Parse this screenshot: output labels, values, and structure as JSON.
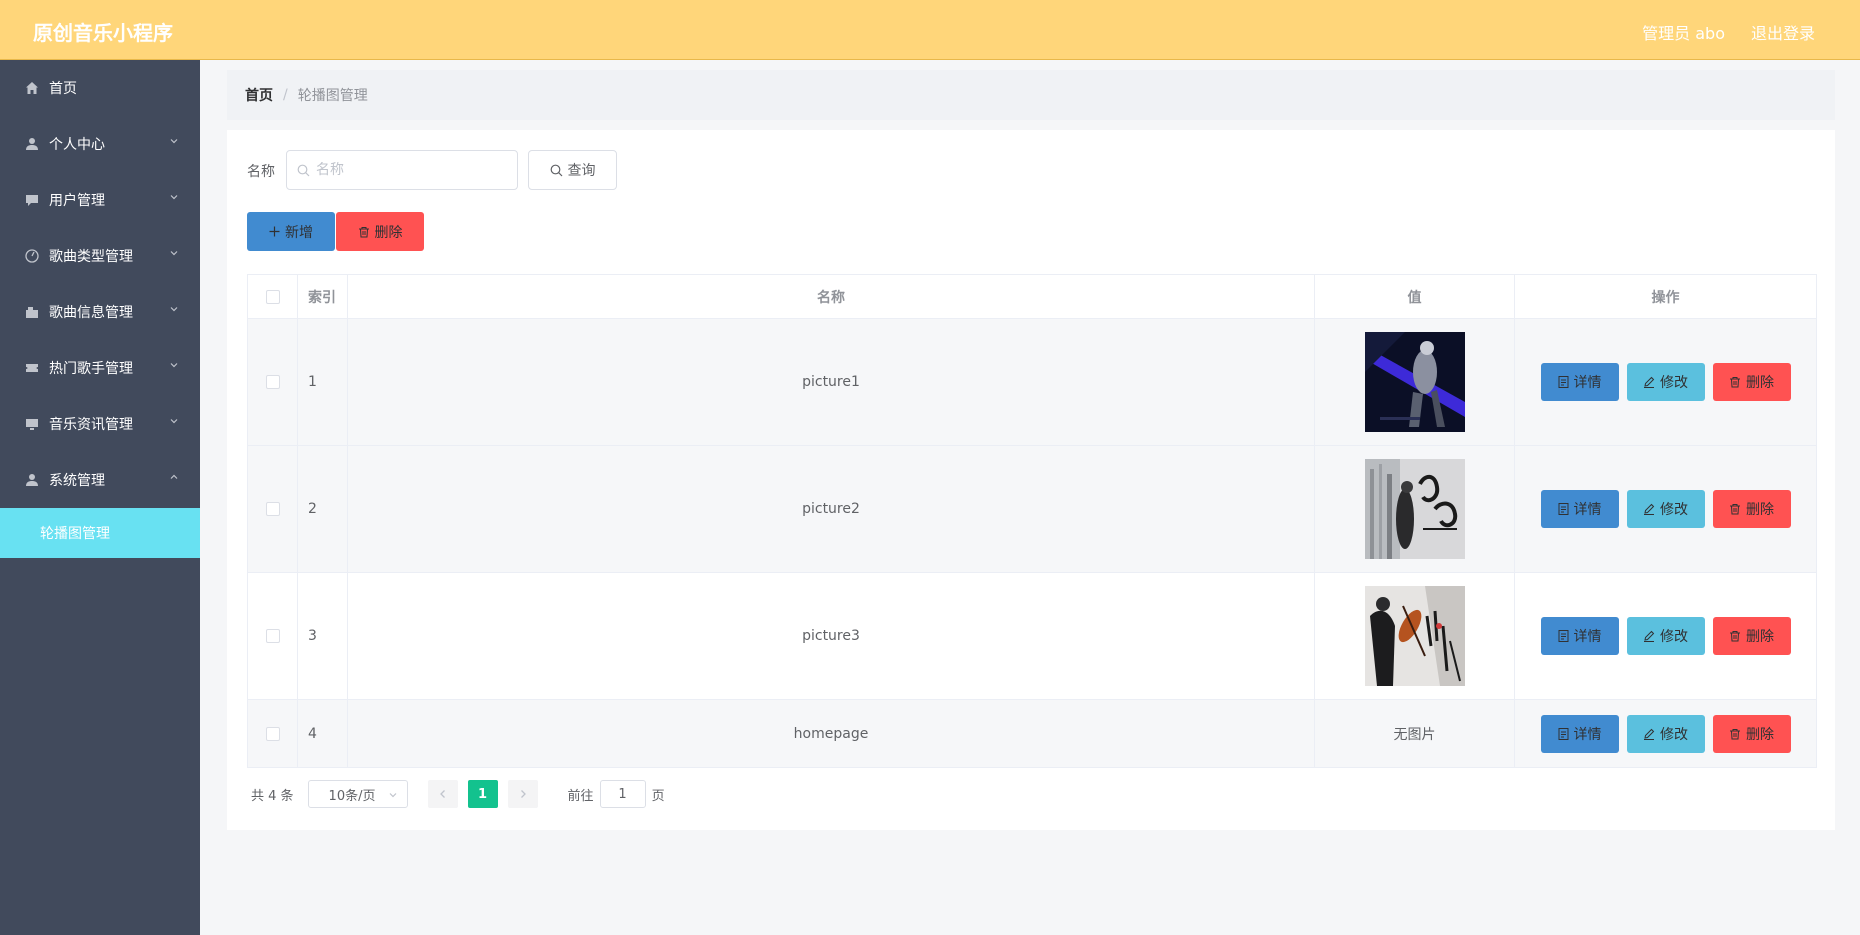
{
  "header": {
    "app_title": "原创音乐小程序",
    "admin_label": "管理员 abo",
    "logout_label": "退出登录"
  },
  "sidebar": {
    "items": [
      {
        "label": "首页",
        "icon": "home-icon"
      },
      {
        "label": "个人中心",
        "icon": "person-icon"
      },
      {
        "label": "用户管理",
        "icon": "chat-icon"
      },
      {
        "label": "歌曲类型管理",
        "icon": "disc-icon"
      },
      {
        "label": "歌曲信息管理",
        "icon": "folder-icon"
      },
      {
        "label": "热门歌手管理",
        "icon": "ticket-icon"
      },
      {
        "label": "音乐资讯管理",
        "icon": "monitor-icon"
      },
      {
        "label": "系统管理",
        "icon": "person-icon"
      }
    ],
    "subitem": {
      "label": "轮播图管理"
    }
  },
  "breadcrumb": {
    "home": "首页",
    "separator": "/",
    "current": "轮播图管理"
  },
  "search": {
    "label": "名称",
    "placeholder": "名称",
    "query_label": "查询"
  },
  "toolbar": {
    "add_label": "新增",
    "delete_label": "删除"
  },
  "table": {
    "headers": {
      "index": "索引",
      "name": "名称",
      "value": "值",
      "ops": "操作"
    },
    "rows": [
      {
        "index": "1",
        "name": "picture1",
        "value": "image"
      },
      {
        "index": "2",
        "name": "picture2",
        "value": "image"
      },
      {
        "index": "3",
        "name": "picture3",
        "value": "image"
      },
      {
        "index": "4",
        "name": "homepage",
        "value": "无图片"
      }
    ],
    "ops": {
      "detail": "详情",
      "edit": "修改",
      "delete": "删除"
    }
  },
  "pagination": {
    "total": "共 4 条",
    "page_size": "10条/页",
    "current_page": "1",
    "goto_label": "前往",
    "goto_value": "1",
    "page_label": "页"
  },
  "colors": {
    "header_bg": "#ffd67a",
    "sidebar_bg": "#414a5c",
    "sidebar_active": "#68e1f2",
    "primary": "#418bd0",
    "info": "#5bc0de",
    "danger": "#ff5252",
    "pager_active": "#13c28e"
  }
}
